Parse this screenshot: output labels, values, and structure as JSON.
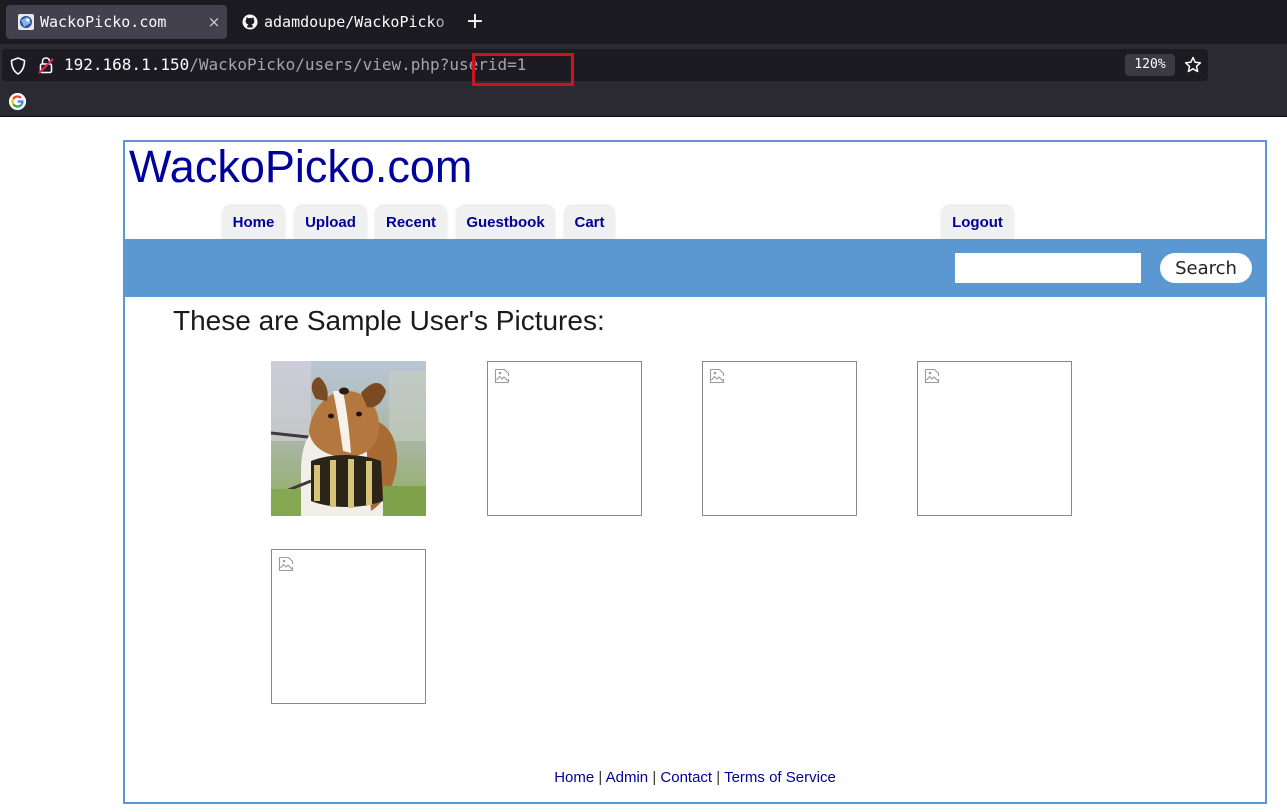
{
  "browser": {
    "tabs": [
      {
        "title": "WackoPicko.com",
        "close_glyph": "×",
        "icon": "site-favicon-icon",
        "active": true
      },
      {
        "title": "adamdoupe/WackoPicko",
        "icon": "github-icon",
        "active": false
      }
    ],
    "new_tab_glyph": "+",
    "url": {
      "host": "192.168.1.150",
      "path": "/WackoPicko/users/view.php?userid=1",
      "highlighted_part": "userid=1",
      "highlight_color": "#d0121f"
    },
    "zoom": "120%",
    "bookmark_icon": "google-icon"
  },
  "site": {
    "logo": "WackoPicko.com",
    "brand_color": "#00009a",
    "bar_color": "#5b97d1",
    "nav": {
      "home": "Home",
      "upload": "Upload",
      "recent": "Recent",
      "guestbook": "Guestbook",
      "cart": "Cart",
      "logout": "Logout"
    },
    "search": {
      "value": "",
      "button": "Search"
    },
    "heading": "These are Sample User's Pictures:",
    "pictures": [
      {
        "kind": "photo",
        "subject": "dog with barrel collar"
      },
      {
        "kind": "broken-image"
      },
      {
        "kind": "broken-image"
      },
      {
        "kind": "broken-image"
      },
      {
        "kind": "broken-image"
      }
    ],
    "footer": {
      "home": "Home",
      "admin": "Admin",
      "contact": "Contact",
      "terms": "Terms of Service",
      "separator": "|"
    }
  }
}
